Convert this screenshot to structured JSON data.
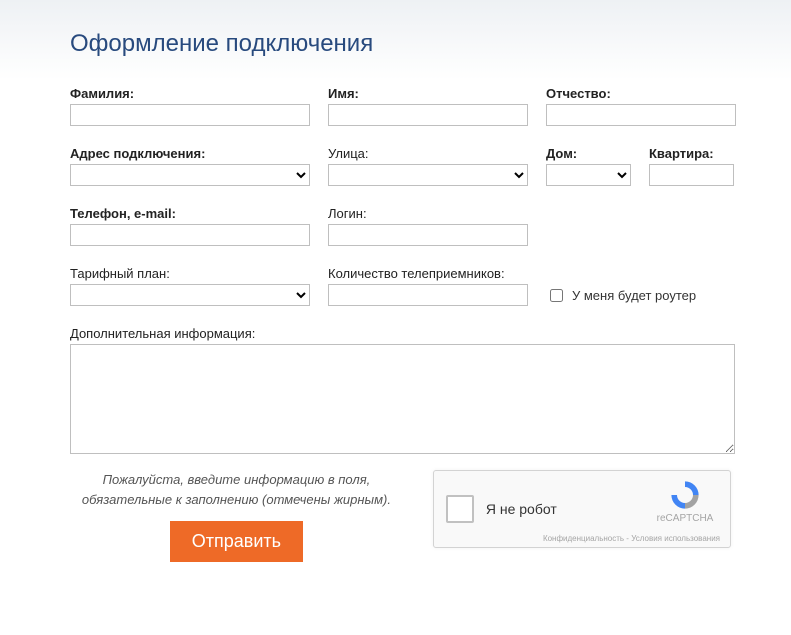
{
  "title": "Оформление подключения",
  "row1": {
    "surname_label": "Фамилия:",
    "name_label": "Имя:",
    "patronymic_label": "Отчество:"
  },
  "row2": {
    "address_label": "Адрес подключения:",
    "street_label": "Улица:",
    "house_label": "Дом:",
    "flat_label": "Квартира:"
  },
  "row3": {
    "contact_label": "Телефон, e-mail:",
    "login_label": "Логин:"
  },
  "row4": {
    "tariff_label": "Тарифный план:",
    "receivers_label": "Количество телеприемников:",
    "router_label": "У меня будет роутер"
  },
  "row5": {
    "extra_label": "Дополнительная информация:"
  },
  "hint": "Пожалуйста, введите информацию в поля, обязательные к заполнению (отмечены жирным).",
  "submit": "Отправить",
  "recaptcha": {
    "label": "Я не робот",
    "brand": "reCAPTCHA",
    "terms": "Конфиденциальность - Условия использования"
  }
}
